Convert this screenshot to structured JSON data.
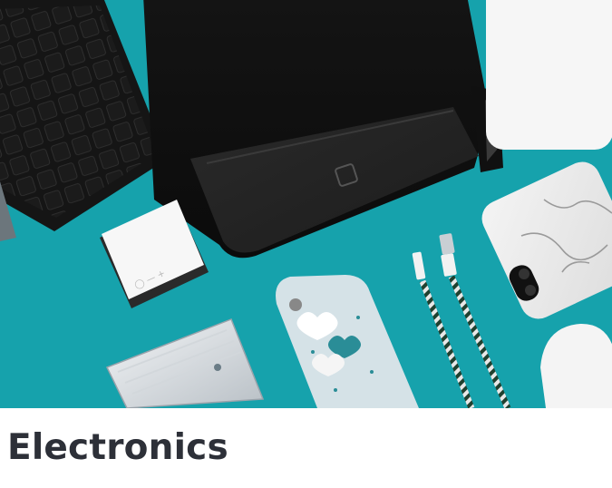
{
  "category_card": {
    "title": "Electronics",
    "image_alt": "Flat lay of electronics accessories: keyboard, laptop sleeve, phone cases, cube speaker, power bank, charging cables and mouse on a teal background",
    "colors": {
      "background": "#16a2ac",
      "title_text": "#2d3038",
      "card_background": "#ffffff"
    }
  }
}
